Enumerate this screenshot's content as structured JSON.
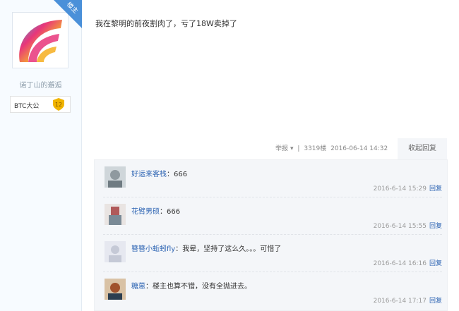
{
  "author": {
    "username": "诺丁山的邂逅",
    "op_badge": "楼主",
    "badge_name": "BTC大公",
    "badge_level": "12"
  },
  "post": {
    "content": "我在黎明的前夜割肉了，亏了18W卖掉了",
    "report_label": "举报",
    "floor": "3319楼",
    "time": "2016-06-14 14:32",
    "collapse_label": "收起回复"
  },
  "replies": [
    {
      "nick": "好运来客栈",
      "content": "666",
      "time": "2016-6-14 15:29",
      "reply_label": "回复"
    },
    {
      "nick": "花臂男硕",
      "content": "666",
      "time": "2016-6-14 15:55",
      "reply_label": "回复"
    },
    {
      "nick": "簪簪小蚯蚓fly",
      "content": "我晕，坚持了这么久。。。可惜了",
      "time": "2016-6-14 16:16",
      "reply_label": "回复"
    },
    {
      "nick": "糖蒽",
      "content": "楼主也算不错，没有全抛进去。",
      "time": "2016-6-14 17:17",
      "reply_label": "回复"
    }
  ],
  "colors": {
    "link_blue": "#2d64b3",
    "op_badge_blue": "#4a90d9",
    "level_gold": "#f0b400"
  }
}
